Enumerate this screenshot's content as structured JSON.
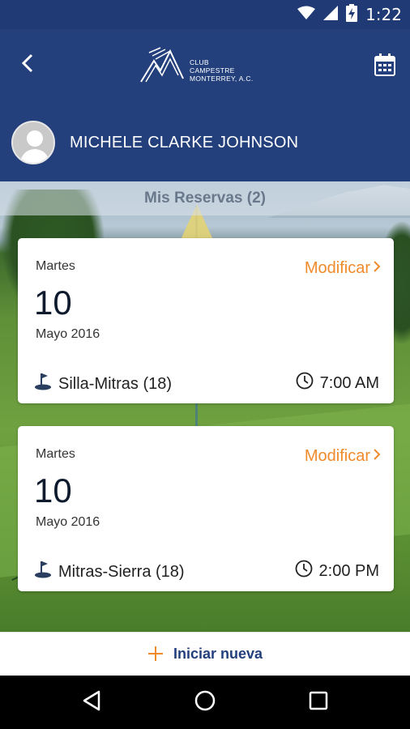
{
  "status_bar": {
    "time": "1:22"
  },
  "header": {
    "logo_text": "CLUB\nCAMPESTRE\nMONTERREY, A.C."
  },
  "profile": {
    "name": "MICHELE CLARKE JOHNSON"
  },
  "section": {
    "title": "Mis Reservas (2)"
  },
  "reservations": [
    {
      "day": "Martes",
      "date": "10",
      "month_year": "Mayo 2016",
      "modify_label": "Modificar",
      "course": "Silla-Mitras (18)",
      "time": "7:00 AM"
    },
    {
      "day": "Martes",
      "date": "10",
      "month_year": "Mayo 2016",
      "modify_label": "Modificar",
      "course": "Mitras-Sierra (18)",
      "time": "2:00 PM"
    }
  ],
  "bottom_action": {
    "label": "Iniciar nueva"
  },
  "colors": {
    "primary": "#23407c",
    "accent": "#f08a2b"
  }
}
